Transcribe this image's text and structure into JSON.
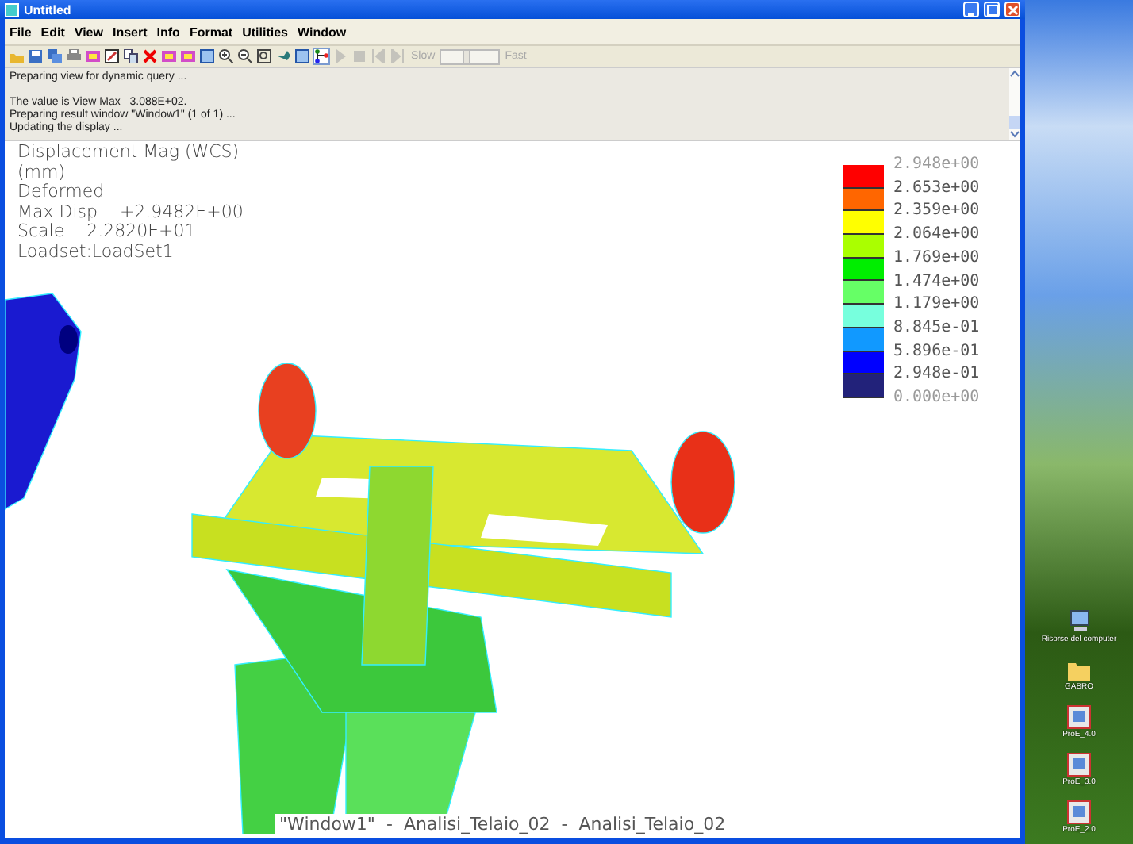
{
  "window": {
    "title": "Untitled"
  },
  "menu": [
    "File",
    "Edit",
    "View",
    "Insert",
    "Info",
    "Format",
    "Utilities",
    "Window"
  ],
  "toolbar": [
    {
      "kind": "open",
      "pressed": false,
      "disabled": false
    },
    {
      "kind": "save",
      "pressed": false,
      "disabled": false
    },
    {
      "kind": "save-all",
      "pressed": false,
      "disabled": false
    },
    {
      "kind": "print",
      "pressed": false,
      "disabled": false
    },
    {
      "kind": "picture",
      "pressed": false,
      "disabled": false
    },
    {
      "kind": "edit",
      "pressed": false,
      "disabled": false
    },
    {
      "kind": "copy",
      "pressed": false,
      "disabled": false
    },
    {
      "kind": "delete",
      "pressed": false,
      "disabled": false
    },
    {
      "kind": "picture",
      "pressed": false,
      "disabled": false
    },
    {
      "kind": "picture",
      "pressed": false,
      "disabled": false
    },
    {
      "kind": "window",
      "pressed": false,
      "disabled": false
    },
    {
      "kind": "zoom-in",
      "pressed": false,
      "disabled": false
    },
    {
      "kind": "zoom-out",
      "pressed": false,
      "disabled": false
    },
    {
      "kind": "zoom-fit",
      "pressed": false,
      "disabled": false
    },
    {
      "kind": "spin",
      "pressed": false,
      "disabled": false
    },
    {
      "kind": "window",
      "pressed": false,
      "disabled": false
    },
    {
      "kind": "query",
      "pressed": true,
      "disabled": false
    },
    {
      "kind": "play",
      "pressed": false,
      "disabled": true
    },
    {
      "kind": "stop",
      "pressed": false,
      "disabled": true
    },
    {
      "kind": "first",
      "pressed": false,
      "disabled": true
    },
    {
      "kind": "last",
      "pressed": false,
      "disabled": true
    }
  ],
  "speed": {
    "min_label": "Slow",
    "max_label": "Fast",
    "level": 0.45,
    "disabled": true
  },
  "log": [
    {
      "text": "Preparing view for dynamic query ...",
      "blank_before": false
    },
    {
      "text": "The value is View Max   3.088E+02.",
      "blank_before": true
    },
    {
      "text": "Preparing result window \"Window1\" (1 of 1) ...",
      "blank_before": false
    },
    {
      "text": "Updating the display ...",
      "blank_before": false
    }
  ],
  "result_info": [
    "Displacement Mag (WCS)",
    "(mm)",
    "Deformed",
    "Max Disp    +2.9482E+00",
    "Scale    2.2820E+01",
    "Loadset:LoadSet1"
  ],
  "legend": {
    "labels": [
      {
        "text": "2.948e+00",
        "dimmed": true
      },
      {
        "text": "2.653e+00",
        "dimmed": false
      },
      {
        "text": "2.359e+00",
        "dimmed": false
      },
      {
        "text": "2.064e+00",
        "dimmed": false
      },
      {
        "text": "1.769e+00",
        "dimmed": false
      },
      {
        "text": "1.474e+00",
        "dimmed": false
      },
      {
        "text": "1.179e+00",
        "dimmed": false
      },
      {
        "text": "8.845e-01",
        "dimmed": false
      },
      {
        "text": "5.896e-01",
        "dimmed": false
      },
      {
        "text": "2.948e-01",
        "dimmed": false
      },
      {
        "text": "0.000e+00",
        "dimmed": true
      }
    ],
    "bands": [
      {
        "color": "#ff0000"
      },
      {
        "color": "#ff6600"
      },
      {
        "color": "#ffff00"
      },
      {
        "color": "#aaff00"
      },
      {
        "color": "#00ee00"
      },
      {
        "color": "#66ff66"
      },
      {
        "color": "#77ffdd"
      },
      {
        "color": "#1199ff"
      },
      {
        "color": "#0000ff"
      },
      {
        "color": "#22227a"
      }
    ]
  },
  "caption": "\"Window1\"  -  Analisi_Telaio_02  -  Analisi_Telaio_02",
  "desktop_icons": [
    {
      "kind": "computer",
      "label": "Risorse del computer"
    },
    {
      "kind": "folder",
      "label": "GABRO"
    },
    {
      "kind": "app",
      "label": "ProE_4.0"
    },
    {
      "kind": "app",
      "label": "ProE_3.0"
    },
    {
      "kind": "app",
      "label": "ProE_2.0"
    }
  ]
}
